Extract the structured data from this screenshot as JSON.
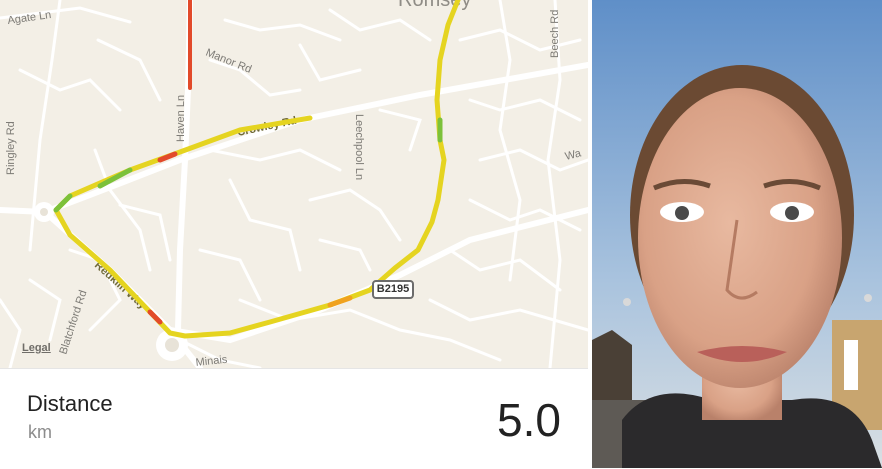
{
  "map": {
    "town": "Romsey",
    "streets": [
      {
        "id": "agate-ln",
        "name": "Agate Ln"
      },
      {
        "id": "ringley-rd",
        "name": "Ringley Rd"
      },
      {
        "id": "manor-rd",
        "name": "Manor Rd"
      },
      {
        "id": "haven-ln",
        "name": "Haven Ln"
      },
      {
        "id": "crowley-rd",
        "name": "Crowley Rd"
      },
      {
        "id": "leechpool-ln",
        "name": "Leechpool Ln"
      },
      {
        "id": "beech-rd",
        "name": "Beech Rd"
      },
      {
        "id": "redkiln-way",
        "name": "Redkiln Way"
      },
      {
        "id": "blatchford-rd",
        "name": "Blatchford Rd"
      },
      {
        "id": "wa",
        "name": "Wa"
      },
      {
        "id": "minais",
        "name": "Minais"
      }
    ],
    "road_badge": "B2195",
    "legal": "Legal",
    "route_colors": [
      "#e5d420",
      "#7cc13a",
      "#e24a2a",
      "#f0a21e"
    ]
  },
  "stats": {
    "label": "Distance",
    "unit": "km",
    "value": "5.0"
  }
}
